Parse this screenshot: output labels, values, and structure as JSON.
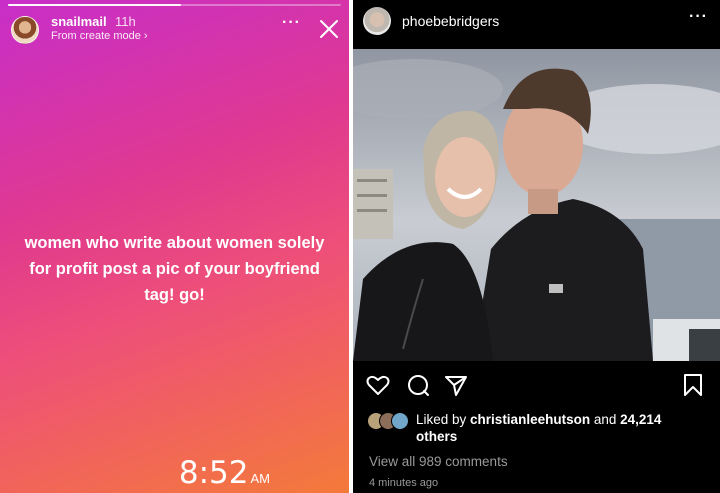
{
  "story": {
    "progress": 0.52,
    "username": "snailmail",
    "time": "11h",
    "subtitle": "From create mode ›",
    "more_icon": "···",
    "close_icon": "close-icon",
    "text": "women who write about women solely for profit post a pic of your boyfriend tag! go!",
    "clock": "8:52",
    "clock_ampm": "AM"
  },
  "post": {
    "username": "phoebebridgers",
    "more_icon": "···",
    "actions": [
      "heart-icon",
      "comment-icon",
      "share-icon",
      "bookmark-icon"
    ],
    "likes_prefix": "Liked by ",
    "liked_by_user": "christianleehutson",
    "likes_mid": " and ",
    "likes_count": "24,214",
    "likes_suffix": "others",
    "comments_label": "View all 989 comments",
    "time_ago": "4 minutes ago"
  },
  "colors": {
    "story_gradient": [
      "#c82ec9",
      "#e0398f",
      "#ee5078",
      "#f47a3a"
    ],
    "post_bg": "#000000",
    "muted_text": "#9a9a9a"
  }
}
